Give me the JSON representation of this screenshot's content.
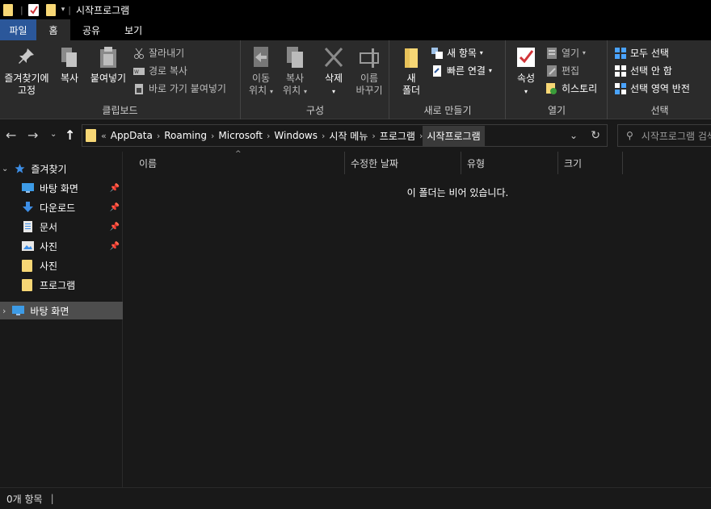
{
  "window": {
    "title": "시작프로그램"
  },
  "tabs": {
    "file": "파일",
    "home": "홈",
    "share": "공유",
    "view": "보기"
  },
  "ribbon": {
    "clipboard": {
      "label": "클립보드",
      "pin_line1": "즐겨찾기에",
      "pin_line2": "고정",
      "copy": "복사",
      "paste": "붙여넣기",
      "cut": "잘라내기",
      "copy_path": "경로 복사",
      "paste_shortcut": "바로 가기 붙여넣기"
    },
    "organize": {
      "label": "구성",
      "move_line1": "이동",
      "move_line2": "위치",
      "copyto_line1": "복사",
      "copyto_line2": "위치",
      "delete": "삭제",
      "rename_line1": "이름",
      "rename_line2": "바꾸기"
    },
    "new": {
      "label": "새로 만들기",
      "folder_line1": "새",
      "folder_line2": "폴더",
      "new_item": "새 항목",
      "easy_access": "빠른 연결"
    },
    "open": {
      "label": "열기",
      "properties": "속성",
      "open": "열기",
      "edit": "편집",
      "history": "히스토리"
    },
    "select": {
      "label": "선택",
      "select_all": "모두 선택",
      "select_none": "선택 안 함",
      "invert": "선택 영역 반전"
    }
  },
  "address": {
    "overflow": "«",
    "crumbs": [
      "AppData",
      "Roaming",
      "Microsoft",
      "Windows",
      "시작 메뉴",
      "프로그램",
      "시작프로그램"
    ],
    "search_placeholder": "시작프로그램 검색"
  },
  "navpane": {
    "quick_access": "즐겨찾기",
    "items": [
      "바탕 화면",
      "다운로드",
      "문서",
      "사진",
      "사진",
      "프로그램"
    ],
    "desktop": "바탕 화면"
  },
  "columns": {
    "name": "이름",
    "modified": "수정한 날짜",
    "type": "유형",
    "size": "크기"
  },
  "content": {
    "empty_message": "이 폴더는 비어 있습니다."
  },
  "status": {
    "item_count": "0개 항목"
  },
  "colors": {
    "file_tab": "#2b579a",
    "folder": "#f7d775",
    "ribbon_bg": "#2b2b2b",
    "window_bg": "#191919",
    "selected_nav": "#4d4d4d"
  }
}
